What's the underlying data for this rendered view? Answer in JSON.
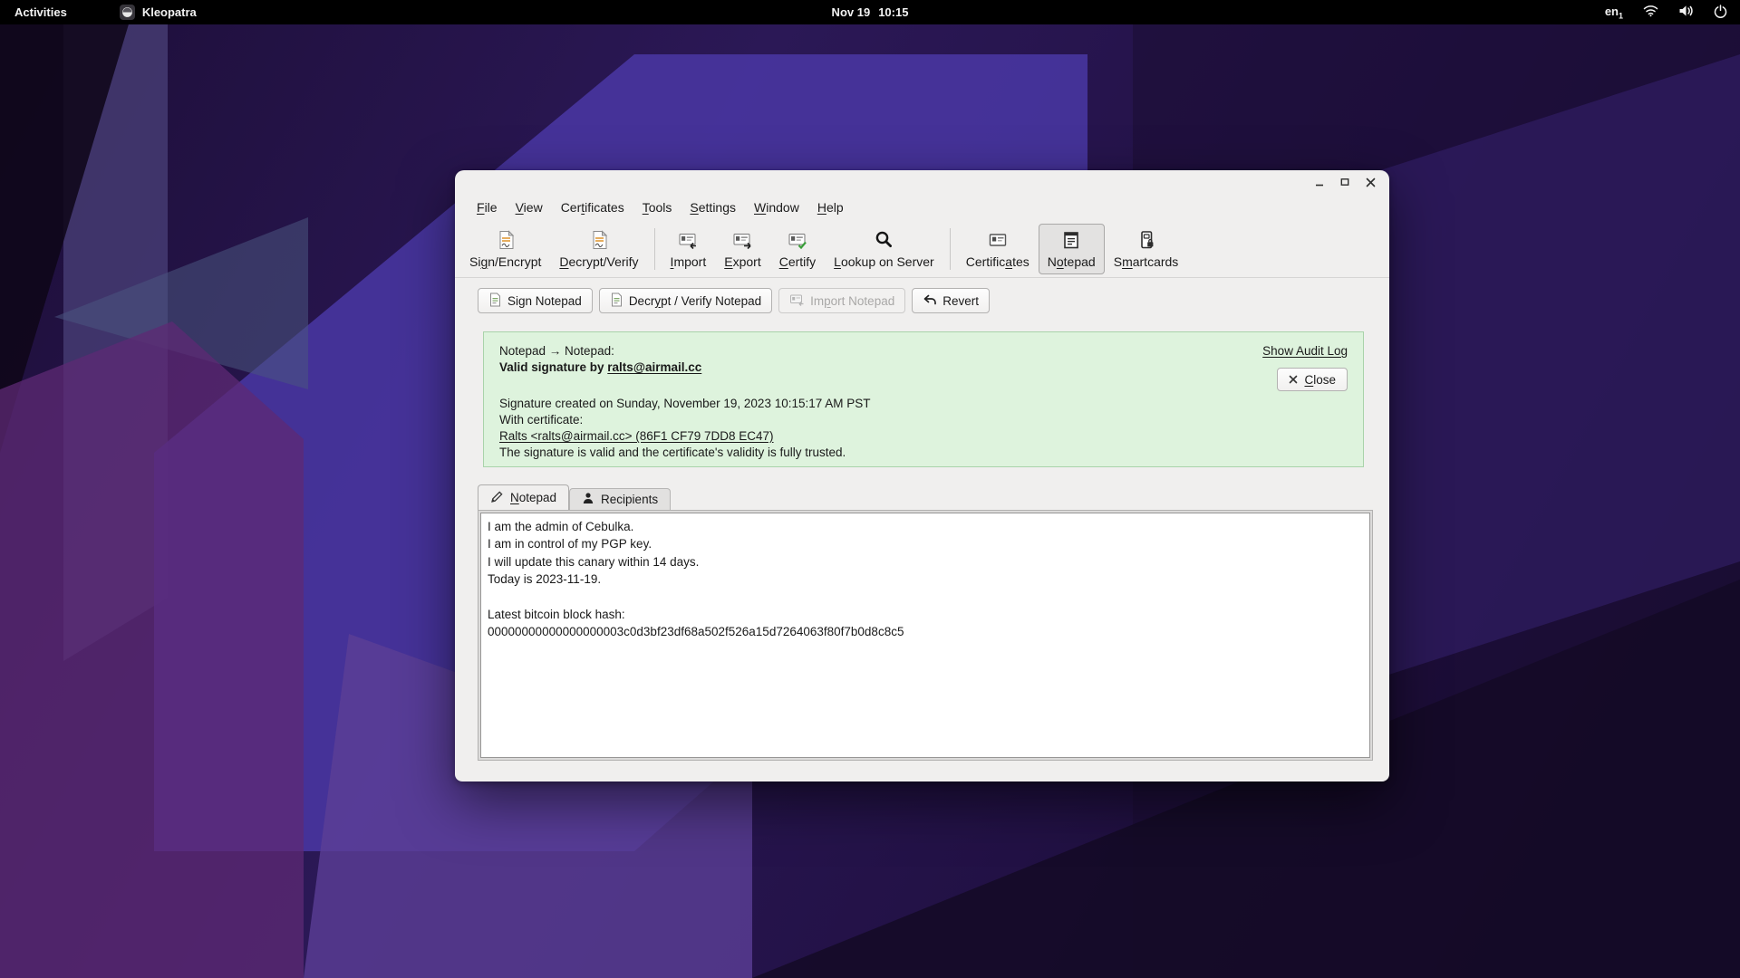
{
  "top_bar": {
    "activities_label": "Activities",
    "app_name": "Kleopatra",
    "clock_date": "Nov 19",
    "clock_time": "10:15",
    "keyboard_layout": "en",
    "keyboard_layout_index": "1"
  },
  "window": {
    "menu": [
      {
        "label": "File",
        "m": 0
      },
      {
        "label": "View",
        "m": 0
      },
      {
        "label": "Certificates",
        "m": 3
      },
      {
        "label": "Tools",
        "m": 0
      },
      {
        "label": "Settings",
        "m": 0
      },
      {
        "label": "Window",
        "m": 0
      },
      {
        "label": "Help",
        "m": 0
      }
    ],
    "toolbar": {
      "sign_encrypt": {
        "label": "Sign/Encrypt",
        "m": 2
      },
      "decrypt_verify": {
        "label": "Decrypt/Verify",
        "m": 0
      },
      "import": {
        "label": "Import",
        "m": 0
      },
      "export": {
        "label": "Export",
        "m": 0
      },
      "certify": {
        "label": "Certify",
        "m": 0
      },
      "lookup": {
        "label": "Lookup on Server",
        "m": 0
      },
      "certificates": {
        "label": "Certificates",
        "m": 8
      },
      "notepad": {
        "label": "Notepad",
        "m": 1
      },
      "smartcards": {
        "label": "Smartcards",
        "m": 1
      }
    },
    "actions": {
      "sign": {
        "label": "Sign Notepad"
      },
      "decrypt": {
        "label": "Decrypt / Verify Notepad",
        "m": 4
      },
      "import": {
        "label": "Import Notepad",
        "m": 2
      },
      "revert": {
        "label": "Revert"
      }
    },
    "result_box": {
      "source_line": "Notepad → Notepad:",
      "valid_prefix": "Valid signature by ",
      "signer_link": "ralts@airmail.cc",
      "created_line": "Signature created on Sunday, November 19, 2023 10:15:17 AM PST",
      "with_cert_label": "With certificate:",
      "cert_link": "Ralts <ralts@airmail.cc> (86F1 CF79 7DD8 EC47)",
      "validity_line": "The signature is valid and the certificate's validity is fully trusted.",
      "audit_link": "Show Audit Log",
      "close": {
        "label": "Close",
        "m": 0
      },
      "bg_color": "#def3dd",
      "border_color": "#a9d3aa"
    },
    "tabs": {
      "notepad": {
        "label": "Notepad",
        "m": 0
      },
      "recipients": {
        "label": "Recipients"
      }
    },
    "notepad_text": "I am the admin of Cebulka.\nI am in control of my PGP key.\nI will update this canary within 14 days.\nToday is 2023-11-19.\n\nLatest bitcoin block hash:\n00000000000000000003c0d3bf23df68a502f526a15d7264063f80f7b0d8c8c5"
  }
}
